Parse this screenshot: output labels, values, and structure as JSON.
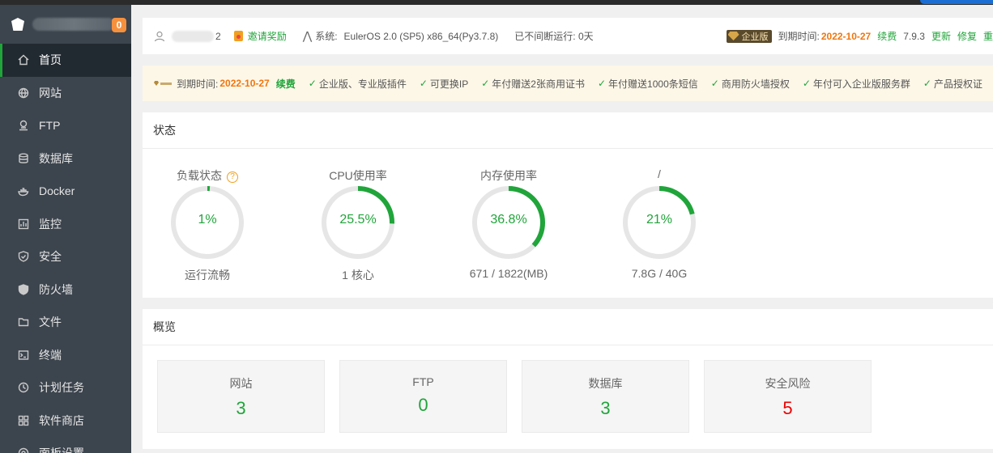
{
  "sidebar": {
    "badge_count": "0",
    "items": [
      {
        "label": "首页",
        "icon": "home-icon",
        "active": true
      },
      {
        "label": "网站",
        "icon": "globe-icon"
      },
      {
        "label": "FTP",
        "icon": "ftp-icon"
      },
      {
        "label": "数据库",
        "icon": "database-icon"
      },
      {
        "label": "Docker",
        "icon": "docker-icon"
      },
      {
        "label": "监控",
        "icon": "monitor-icon"
      },
      {
        "label": "安全",
        "icon": "shield-icon"
      },
      {
        "label": "防火墙",
        "icon": "firewall-icon"
      },
      {
        "label": "文件",
        "icon": "folder-icon"
      },
      {
        "label": "终端",
        "icon": "terminal-icon"
      },
      {
        "label": "计划任务",
        "icon": "clock-icon"
      },
      {
        "label": "软件商店",
        "icon": "grid-icon"
      },
      {
        "label": "面板设置",
        "icon": "settings-icon"
      }
    ]
  },
  "header": {
    "user_suffix": "2",
    "reward_label": "邀请奖励",
    "system_label": "系统:",
    "os": "EulerOS 2.0 (SP5) x86_64(Py3.7.8)",
    "uptime": "已不间断运行: 0天",
    "edition_tag": "企业版",
    "expiry_label": "到期时间:",
    "expiry_date": "2022-10-27",
    "renew_label": "续费",
    "version": "7.9.3",
    "update_label": "更新",
    "repair_label": "修复",
    "restart_label": "重"
  },
  "promo": {
    "expiry_label": "到期时间:",
    "expiry_date": "2022-10-27",
    "renew_label": "续费",
    "features": [
      "企业版、专业版插件",
      "可更换IP",
      "年付赠送2张商用证书",
      "年付赠送1000条短信",
      "商用防火墙授权",
      "年付可入企业版服务群",
      "产品授权证"
    ]
  },
  "status": {
    "title": "状态",
    "gauges": [
      {
        "title": "负载状态",
        "value": "1%",
        "percent": 1,
        "sub": "运行流畅",
        "help": "?"
      },
      {
        "title": "CPU使用率",
        "value": "25.5%",
        "percent": 25.5,
        "sub": "1 核心"
      },
      {
        "title": "内存使用率",
        "value": "36.8%",
        "percent": 36.8,
        "sub": "671 / 1822(MB)"
      },
      {
        "title": "/",
        "value": "21%",
        "percent": 21,
        "sub": "7.8G / 40G"
      }
    ]
  },
  "overview": {
    "title": "概览",
    "cards": [
      {
        "label": "网站",
        "value": "3"
      },
      {
        "label": "FTP",
        "value": "0"
      },
      {
        "label": "数据库",
        "value": "3"
      },
      {
        "label": "安全风险",
        "value": "5"
      }
    ]
  },
  "colors": {
    "accent": "#20a53a",
    "sidebar_bg": "#3c444d",
    "sidebar_active": "#222a31",
    "warning_orange": "#f0760e",
    "risk_red": "#ee0000",
    "gauge_track": "#e6e6e6"
  }
}
